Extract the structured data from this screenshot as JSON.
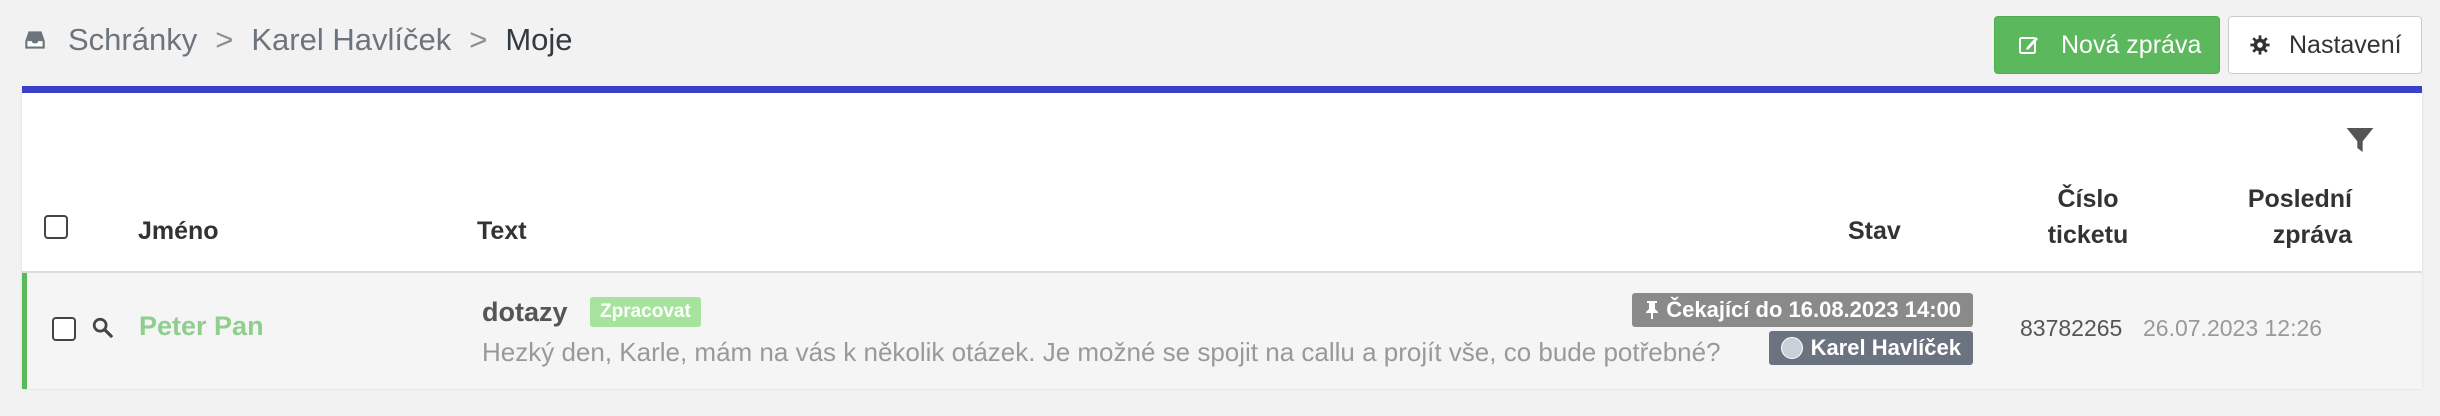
{
  "breadcrumb": {
    "items": [
      "Schránky",
      "Karel Havlíček"
    ],
    "separator": ">",
    "current": "Moje"
  },
  "toolbar": {
    "new_message_label": "Nová zpráva",
    "settings_label": "Nastavení"
  },
  "table": {
    "headers": {
      "name": "Jméno",
      "text": "Text",
      "status": "Stav",
      "ticket_number": "Číslo ticketu",
      "last_message": "Poslední zpráva"
    },
    "rows": [
      {
        "name": "Peter Pan",
        "subject": "dotazy",
        "tag": "Zpracovat",
        "preview": "Hezký den, Karle, mám na vás k několik otázek. Je možné se spojit na callu a projít vše, co bude potřebné?",
        "status_waiting": "Čekající do 16.08.2023 14:00",
        "assignee": "Karel Havlíček",
        "ticket_number": "83782265",
        "last_message": "26.07.2023 12:26"
      }
    ]
  },
  "icons": {
    "breadcrumb": "inbox-icon",
    "new_message": "edit-icon",
    "settings": "gear-icon",
    "filter": "filter-icon",
    "row_search": "search-icon",
    "status": "pin-icon",
    "assignee": "avatar-icon"
  },
  "colors": {
    "accent": "#3a41c9",
    "success": "#5cb85c",
    "name_link": "#8fce8f",
    "tag": "#a6e39c"
  }
}
